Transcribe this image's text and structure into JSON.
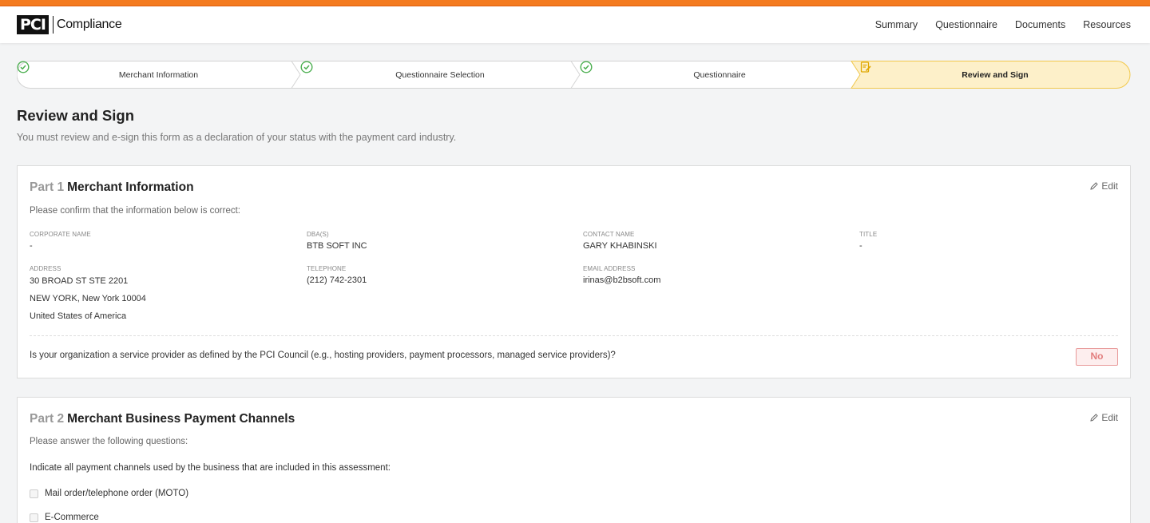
{
  "header": {
    "logo_mark": "PCI",
    "logo_text": "Compliance",
    "nav": [
      "Summary",
      "Questionnaire",
      "Documents",
      "Resources"
    ]
  },
  "colors": {
    "accent": "#f47b20",
    "step_done": "#4caf50",
    "step_active_bg": "#fdf0c9",
    "step_active_border": "#f2c94c",
    "no_badge": "#e27d7d"
  },
  "stepper": {
    "steps": [
      {
        "label": "Merchant Information",
        "status": "done",
        "icon": "check-circle-icon"
      },
      {
        "label": "Questionnaire Selection",
        "status": "done",
        "icon": "check-circle-icon"
      },
      {
        "label": "Questionnaire",
        "status": "done",
        "icon": "check-circle-icon"
      },
      {
        "label": "Review and Sign",
        "status": "active",
        "icon": "sign-document-icon"
      }
    ]
  },
  "page": {
    "title": "Review and Sign",
    "subtitle": "You must review and e-sign this form as a declaration of your status with the payment card industry."
  },
  "part1": {
    "num": "Part 1",
    "title": "Merchant Information",
    "edit": "Edit",
    "desc": "Please confirm that the information below is correct:",
    "fields": {
      "corporate_name": {
        "label": "CORPORATE NAME",
        "value": "-"
      },
      "dba": {
        "label": "DBA(S)",
        "value": "BTB SOFT INC"
      },
      "contact_name": {
        "label": "CONTACT NAME",
        "value": "GARY KHABINSKI"
      },
      "title": {
        "label": "TITLE",
        "value": "-"
      },
      "address": {
        "label": "ADDRESS",
        "lines": [
          "30 BROAD ST STE 2201",
          "NEW YORK, New York 10004",
          "United States of America"
        ]
      },
      "telephone": {
        "label": "TELEPHONE",
        "value": "(212) 742-2301"
      },
      "email": {
        "label": "EMAIL ADDRESS",
        "value": "irinas@b2bsoft.com"
      }
    },
    "service_provider_question": "Is your organization a service provider as defined by the PCI Council (e.g., hosting providers, payment processors, managed service providers)?",
    "service_provider_answer": "No"
  },
  "part2": {
    "num": "Part 2",
    "title": "Merchant Business Payment Channels",
    "edit": "Edit",
    "desc": "Please answer the following questions:",
    "channels_question": "Indicate all payment channels used by the business that are included in this assessment:",
    "channels": [
      "Mail order/telephone order (MOTO)",
      "E-Commerce"
    ]
  }
}
